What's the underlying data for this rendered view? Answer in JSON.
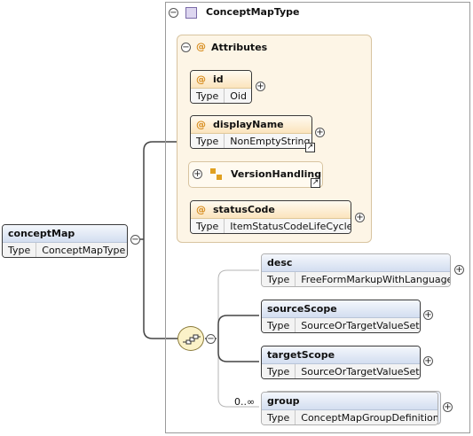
{
  "complex_type": {
    "title": "ConceptMapType"
  },
  "attributes_group": {
    "title": "Attributes"
  },
  "attributes": [
    {
      "name": "id",
      "type_key": "Type",
      "type": "Oid"
    },
    {
      "name": "displayName",
      "type_key": "Type",
      "type": "NonEmptyString"
    },
    {
      "name": "statusCode",
      "type_key": "Type",
      "type": "ItemStatusCodeLifeCycle"
    }
  ],
  "attribute_group_ref": {
    "name": "VersionHandling"
  },
  "root_element": {
    "name": "conceptMap",
    "type_key": "Type",
    "type": "ConceptMapType"
  },
  "children": [
    {
      "name": "desc",
      "type_key": "Type",
      "type": "FreeFormMarkupWithLanguage"
    },
    {
      "name": "sourceScope",
      "type_key": "Type",
      "type": "SourceOrTargetValueSet"
    },
    {
      "name": "targetScope",
      "type_key": "Type",
      "type": "SourceOrTargetValueSet"
    },
    {
      "name": "group",
      "type_key": "Type",
      "type": "ConceptMapGroupDefinition",
      "cardinality": "0..∞"
    }
  ],
  "colors": {
    "element_header": "#d3def0",
    "attribute_header": "#fbe4bd",
    "panel_bg": "#fdf5e6",
    "compositor_fill": "#fbf2c8"
  },
  "icons": {
    "expand": "plus-circle",
    "collapse": "minus-circle",
    "link": "link-arrow",
    "sequence": "sequence-compositor"
  }
}
